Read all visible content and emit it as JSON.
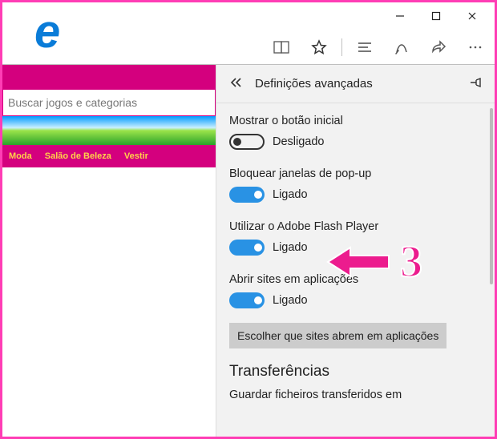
{
  "window_controls": {
    "minimize": "minimize",
    "maximize": "maximize",
    "close": "close"
  },
  "browser_logo_letter": "e",
  "toolbar_icons": {
    "reading_list": "reading-list",
    "favorite": "favorite-star",
    "hub": "hub-lines",
    "notes": "add-notes",
    "share": "share",
    "more": "more-ellipsis"
  },
  "webpage": {
    "search_placeholder": "Buscar jogos e categorias",
    "nav": [
      "Moda",
      "Salão de Beleza",
      "Vestir"
    ]
  },
  "panel": {
    "back_icon": "chevrons-left",
    "title": "Definições avançadas",
    "pin_icon": "pin",
    "settings": [
      {
        "label": "Mostrar o botão inicial",
        "state": "off",
        "state_text": "Desligado"
      },
      {
        "label": "Bloquear janelas de pop-up",
        "state": "on",
        "state_text": "Ligado"
      },
      {
        "label": "Utilizar o Adobe Flash Player",
        "state": "on",
        "state_text": "Ligado"
      },
      {
        "label": "Abrir sites em aplicações",
        "state": "on",
        "state_text": "Ligado"
      }
    ],
    "choose_sites_button": "Escolher que sites abrem em aplicações",
    "transfers_heading": "Transferências",
    "downloads_label": "Guardar ficheiros transferidos em"
  },
  "annotation": {
    "step_number": "3"
  }
}
